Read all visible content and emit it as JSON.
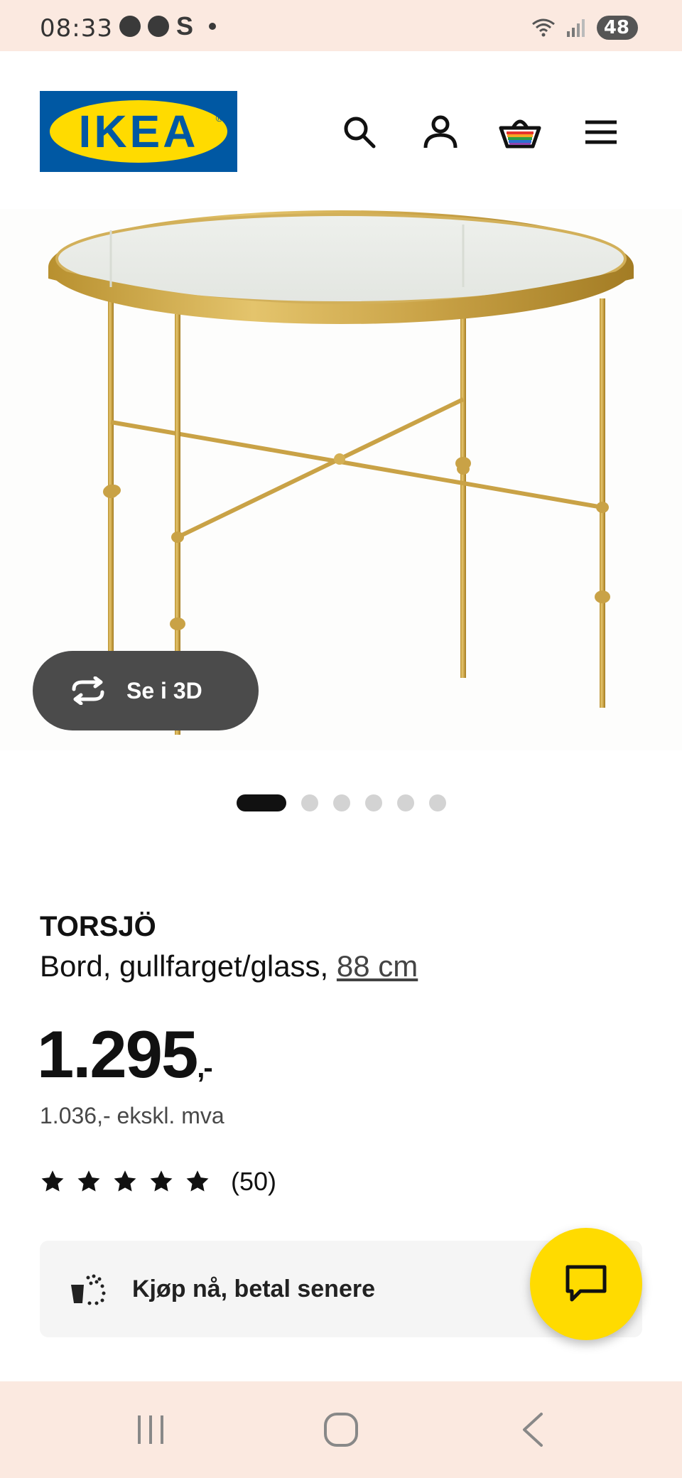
{
  "status_bar": {
    "time": "08:33",
    "s_glyph": "S",
    "battery": "48",
    "icons": [
      "messenger-icon",
      "chat-icon",
      "s-icon",
      "dot-icon",
      "wifi-icon",
      "signal-icon",
      "battery-icon"
    ]
  },
  "header": {
    "logo_text": "IKEA",
    "logo_reg": "®",
    "logo_colors": {
      "blue": "#0058a3",
      "yellow": "#ffdb00"
    },
    "icons": [
      "search-icon",
      "user-icon",
      "shopping-basket-icon",
      "menu-icon"
    ]
  },
  "product": {
    "view_3d_label": "Se i 3D",
    "gallery_count": 6,
    "gallery_active_index": 0,
    "name": "TORSJÖ",
    "description": "Bord, gullfarget/glass, ",
    "size": "88 cm",
    "price": "1.295",
    "price_suffix": ",-",
    "price_ex_vat": "1.036,- ekskl. mva",
    "rating_stars": 5,
    "rating_count": "(50)"
  },
  "bnpl": {
    "label": "Kjøp nå, betal senere",
    "icon": "bnpl-icon"
  },
  "chat": {
    "icon": "chat-bubble-icon",
    "color": "#ffdb00"
  },
  "nav_bar": {
    "icons": [
      "recent-apps-icon",
      "home-icon",
      "back-icon"
    ]
  }
}
